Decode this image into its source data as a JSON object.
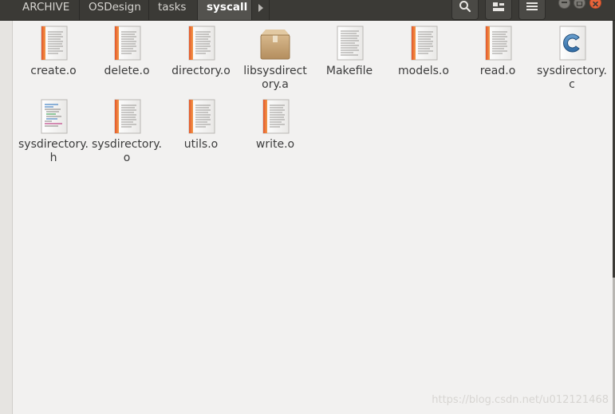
{
  "breadcrumbs": [
    "ARCHIVE",
    "OSDesign",
    "tasks",
    "syscall"
  ],
  "header_icons": [
    "search-icon",
    "view-toggle-icon",
    "menu-icon"
  ],
  "window_controls": [
    "minimize",
    "maximize",
    "close"
  ],
  "files": [
    {
      "name": "create.o",
      "icon": "object-file-icon"
    },
    {
      "name": "delete.o",
      "icon": "object-file-icon"
    },
    {
      "name": "directory.o",
      "icon": "object-file-icon"
    },
    {
      "name": "libsysdirectory.a",
      "icon": "archive-package-icon"
    },
    {
      "name": "Makefile",
      "icon": "text-file-icon"
    },
    {
      "name": "models.o",
      "icon": "object-file-icon"
    },
    {
      "name": "read.o",
      "icon": "object-file-icon"
    },
    {
      "name": "sysdirectory.c",
      "icon": "c-source-file-icon"
    },
    {
      "name": "sysdirectory.h",
      "icon": "c-header-file-icon"
    },
    {
      "name": "sysdirectory.o",
      "icon": "object-file-icon"
    },
    {
      "name": "utils.o",
      "icon": "object-file-icon"
    },
    {
      "name": "write.o",
      "icon": "object-file-icon"
    }
  ],
  "watermark": "https://blog.csdn.net/u012121468"
}
